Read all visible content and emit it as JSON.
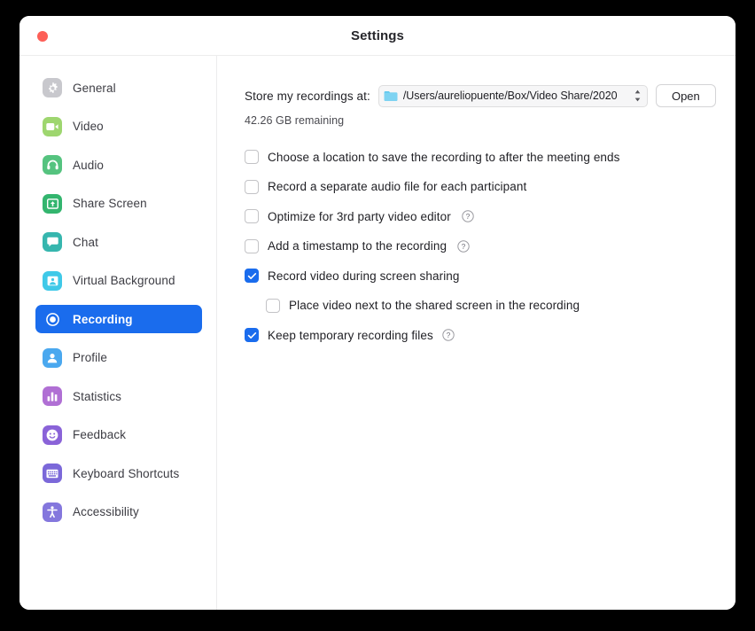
{
  "window": {
    "title": "Settings",
    "traffic_lights": [
      {
        "name": "close",
        "color": "#fd5f57"
      }
    ]
  },
  "sidebar": {
    "items": [
      {
        "label": "General",
        "icon": "gear-icon",
        "color": "#c8c8cd",
        "active": false
      },
      {
        "label": "Video",
        "icon": "video-camera-icon",
        "color": "#9ed66f",
        "active": false
      },
      {
        "label": "Audio",
        "icon": "headphones-icon",
        "color": "#55c37f",
        "active": false
      },
      {
        "label": "Share Screen",
        "icon": "share-screen-icon",
        "color": "#33b56e",
        "active": false
      },
      {
        "label": "Chat",
        "icon": "chat-bubble-icon",
        "color": "#36b6ae",
        "active": false
      },
      {
        "label": "Virtual Background",
        "icon": "virtual-background-icon",
        "color": "#3fc9e8",
        "active": false
      },
      {
        "label": "Recording",
        "icon": "record-circle-icon",
        "color": "#1a6ced",
        "active": true
      },
      {
        "label": "Profile",
        "icon": "person-icon",
        "color": "#4aa8ef",
        "active": false
      },
      {
        "label": "Statistics",
        "icon": "bar-chart-icon",
        "color": "#b06fd4",
        "active": false
      },
      {
        "label": "Feedback",
        "icon": "smiley-face-icon",
        "color": "#8a63d8",
        "active": false
      },
      {
        "label": "Keyboard Shortcuts",
        "icon": "keyboard-icon",
        "color": "#7b68d9",
        "active": false
      },
      {
        "label": "Accessibility",
        "icon": "accessibility-icon",
        "color": "#8477dd",
        "active": false
      }
    ]
  },
  "main": {
    "store_label": "Store my recordings at:",
    "path_value": "/Users/aureliopuente/Box/Video Share/2020",
    "open_label": "Open",
    "remaining": "42.26 GB remaining",
    "options": [
      {
        "label": "Choose a location to save the recording to after the meeting ends",
        "checked": false,
        "help": false,
        "indented": false
      },
      {
        "label": "Record a separate audio file for each participant",
        "checked": false,
        "help": false,
        "indented": false
      },
      {
        "label": "Optimize for 3rd party video editor",
        "checked": false,
        "help": true,
        "indented": false
      },
      {
        "label": "Add a timestamp to the recording",
        "checked": false,
        "help": true,
        "indented": false
      },
      {
        "label": "Record video during screen sharing",
        "checked": true,
        "help": false,
        "indented": false
      },
      {
        "label": "Place video next to the shared screen in the recording",
        "checked": false,
        "help": false,
        "indented": true
      },
      {
        "label": "Keep temporary recording files",
        "checked": true,
        "help": true,
        "indented": false,
        "help_tight": true
      }
    ]
  },
  "colors": {
    "accent": "#1a6ced",
    "window_bg": "#ffffff",
    "desktop_bg": "#000000",
    "divider": "#ececed",
    "text_primary": "#1f1f24",
    "text_secondary": "#4a4a50"
  }
}
